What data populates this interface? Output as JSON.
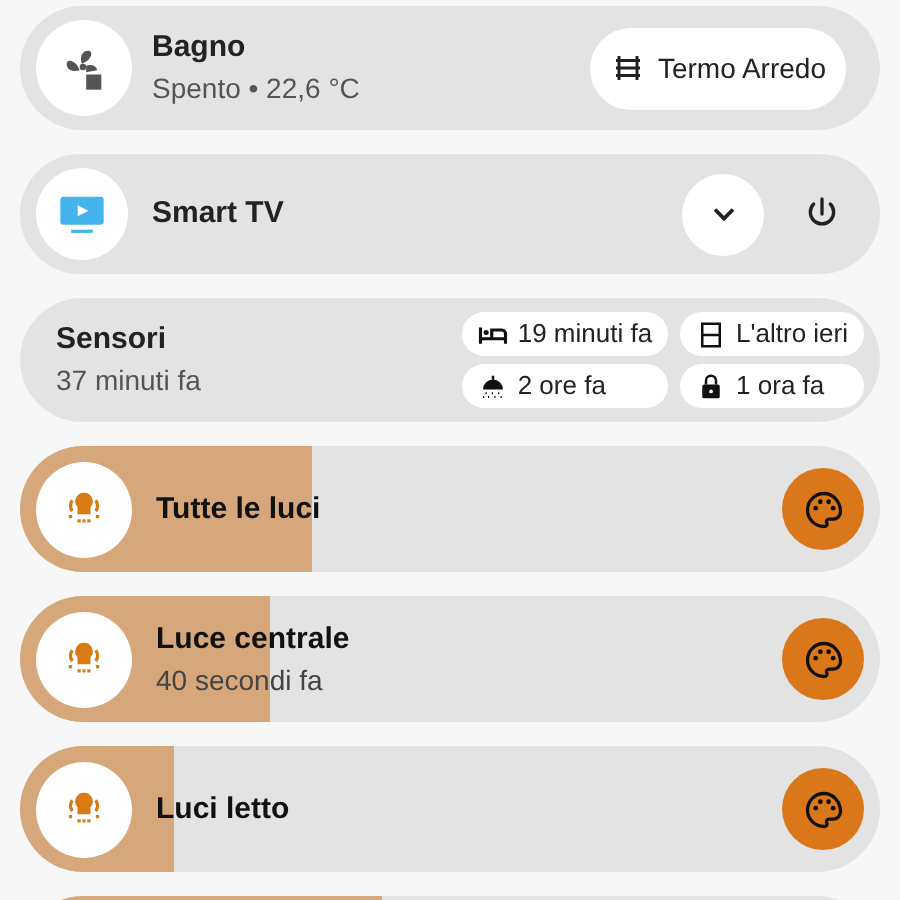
{
  "climate": {
    "title": "Bagno",
    "state": "Spento • 22,6 °C",
    "button": "Termo Arredo"
  },
  "media": {
    "title": "Smart TV"
  },
  "sensors": {
    "title": "Sensori",
    "subtitle": "37 minuti fa",
    "chips": [
      {
        "kind": "bed",
        "label": "19 minuti fa"
      },
      {
        "kind": "door",
        "label": "L'altro ieri"
      },
      {
        "kind": "shower",
        "label": "2 ore fa"
      },
      {
        "kind": "lock",
        "label": "1 ora fa"
      }
    ]
  },
  "lights": [
    {
      "name": "Tutte le luci",
      "level": 0.34
    },
    {
      "name": "Luce centrale",
      "subtitle": "40 secondi fa",
      "level": 0.29
    },
    {
      "name": "Luci letto",
      "level": 0.18
    },
    {
      "level": 0.42
    }
  ]
}
